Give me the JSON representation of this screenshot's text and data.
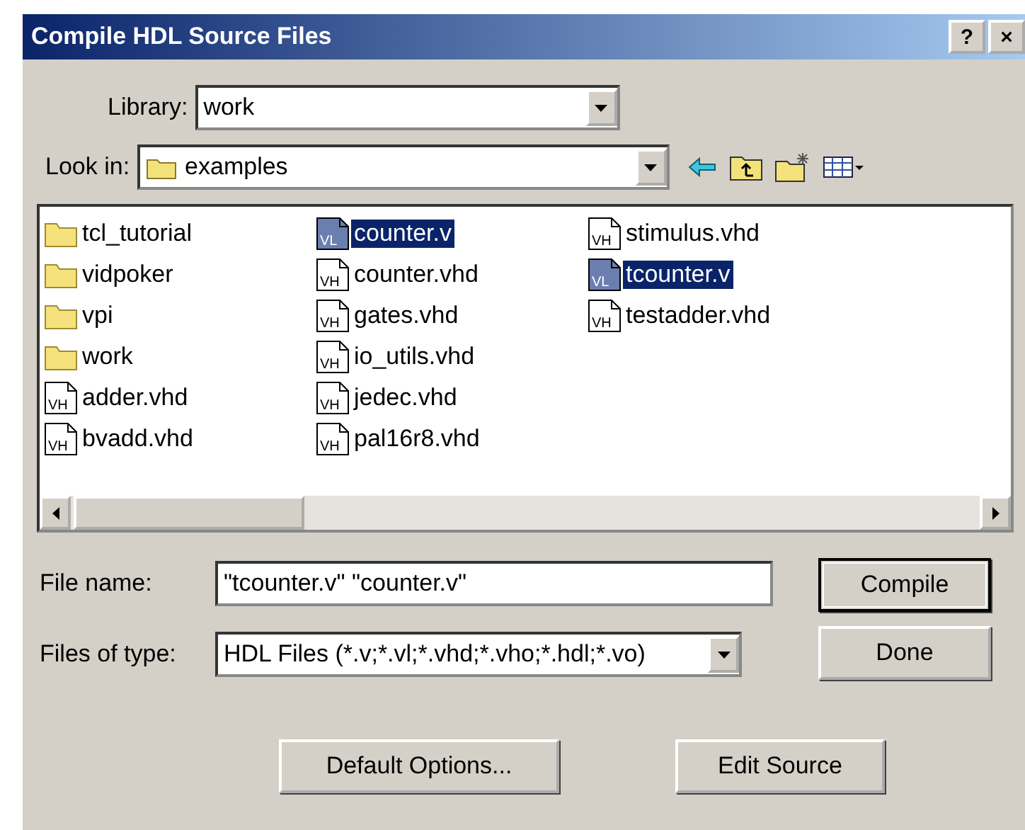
{
  "window": {
    "title": "Compile HDL Source Files",
    "controls": [
      "?",
      "×"
    ]
  },
  "library": {
    "label": "Library:",
    "value": "work"
  },
  "look_in": {
    "label": "Look in:",
    "value": "examples"
  },
  "files": [
    {
      "name": "tcl_tutorial",
      "kind": "folder",
      "selected": false
    },
    {
      "name": "vidpoker",
      "kind": "folder",
      "selected": false
    },
    {
      "name": "vpi",
      "kind": "folder",
      "selected": false
    },
    {
      "name": "work",
      "kind": "folder",
      "selected": false
    },
    {
      "name": "adder.vhd",
      "kind": "vhdl",
      "badge": "VH",
      "selected": false
    },
    {
      "name": "bvadd.vhd",
      "kind": "vhdl",
      "badge": "VH",
      "selected": false
    },
    {
      "name": "counter.v",
      "kind": "verilog",
      "badge": "VL",
      "selected": true
    },
    {
      "name": "counter.vhd",
      "kind": "vhdl",
      "badge": "VH",
      "selected": false
    },
    {
      "name": "gates.vhd",
      "kind": "vhdl",
      "badge": "VH",
      "selected": false
    },
    {
      "name": "io_utils.vhd",
      "kind": "vhdl",
      "badge": "VH",
      "selected": false
    },
    {
      "name": "jedec.vhd",
      "kind": "vhdl",
      "badge": "VH",
      "selected": false
    },
    {
      "name": "pal16r8.vhd",
      "kind": "vhdl",
      "badge": "VH",
      "selected": false
    },
    {
      "name": "stimulus.vhd",
      "kind": "vhdl",
      "badge": "VH",
      "selected": false
    },
    {
      "name": "tcounter.v",
      "kind": "verilog",
      "badge": "VL",
      "selected": true
    },
    {
      "name": "testadder.vhd",
      "kind": "vhdl",
      "badge": "VH",
      "selected": false
    }
  ],
  "file_name": {
    "label": "File name:",
    "value": "\"tcounter.v\" \"counter.v\""
  },
  "files_of_type": {
    "label": "Files of type:",
    "value": "HDL Files (*.v;*.vl;*.vhd;*.vho;*.hdl;*.vo)"
  },
  "side_buttons": [
    "Compile",
    "Done"
  ],
  "bottom_buttons": [
    "Default Options...",
    "Edit Source"
  ]
}
